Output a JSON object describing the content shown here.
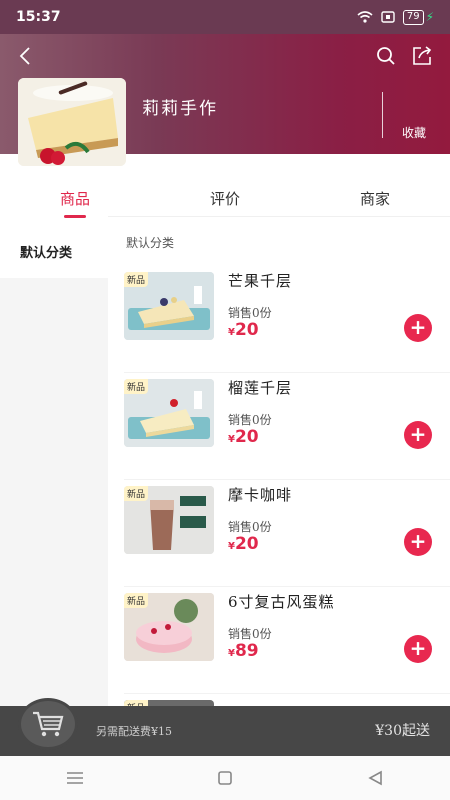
{
  "status_bar": {
    "time": "15:37",
    "battery": "79"
  },
  "shop": {
    "name": "莉莉手作",
    "favorite_label": "收藏"
  },
  "tabs": [
    {
      "label": "商品",
      "active": true
    },
    {
      "label": "评价",
      "active": false
    },
    {
      "label": "商家",
      "active": false
    }
  ],
  "sidebar": {
    "items": [
      {
        "label": "默认分类",
        "active": true
      }
    ]
  },
  "category_title": "默认分类",
  "products": [
    {
      "badge": "新品",
      "name": "芒果千层",
      "sales": "销售0份",
      "currency": "¥",
      "price": "20"
    },
    {
      "badge": "新品",
      "name": "榴莲千层",
      "sales": "销售0份",
      "currency": "¥",
      "price": "20"
    },
    {
      "badge": "新品",
      "name": "摩卡咖啡",
      "sales": "销售0份",
      "currency": "¥",
      "price": "20"
    },
    {
      "badge": "新品",
      "name": "6寸复古风蛋糕",
      "sales": "销售0份",
      "currency": "¥",
      "price": "89"
    },
    {
      "badge": "新品",
      "name": ""
    }
  ],
  "cart_bar": {
    "delivery_fee": "另需配送费¥15",
    "min_order": "¥30起送"
  },
  "colors": {
    "accent": "#e0284c",
    "header_start": "#8a5a6c",
    "header_end": "#931a3e",
    "cart_bar": "#474747"
  },
  "icons": {
    "back": "back-arrow-icon",
    "search": "search-icon",
    "share": "share-icon",
    "cart": "cart-icon"
  }
}
